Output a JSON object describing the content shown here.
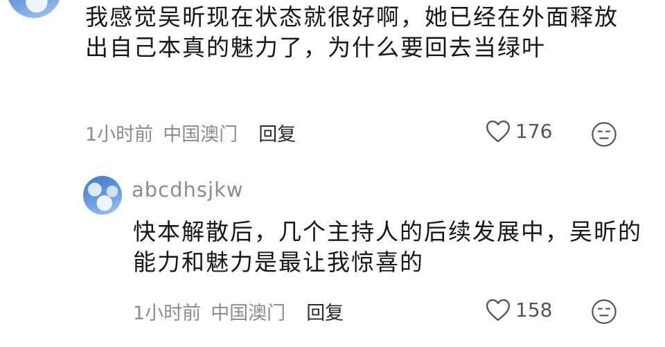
{
  "comments": [
    {
      "text": "我感觉吴昕现在状态就很好啊，她已经在外面释放出自己本真的魅力了，为什么要回去当绿叶",
      "time": "1小时前",
      "location": "中国澳门",
      "reply_label": "回复",
      "likes": "176",
      "like_icon": "heart-outline-icon",
      "emoji_icon": "neutral-face-icon"
    }
  ],
  "reply": {
    "username": "abcdhsjkw",
    "text": "快本解散后，几个主持人的后续发展中，吴昕的能力和魅力是最让我惊喜的",
    "time": "1小时前",
    "location": "中国澳门",
    "reply_label": "回复",
    "likes": "158",
    "like_icon": "heart-outline-icon",
    "emoji_icon": "neutral-face-icon"
  }
}
